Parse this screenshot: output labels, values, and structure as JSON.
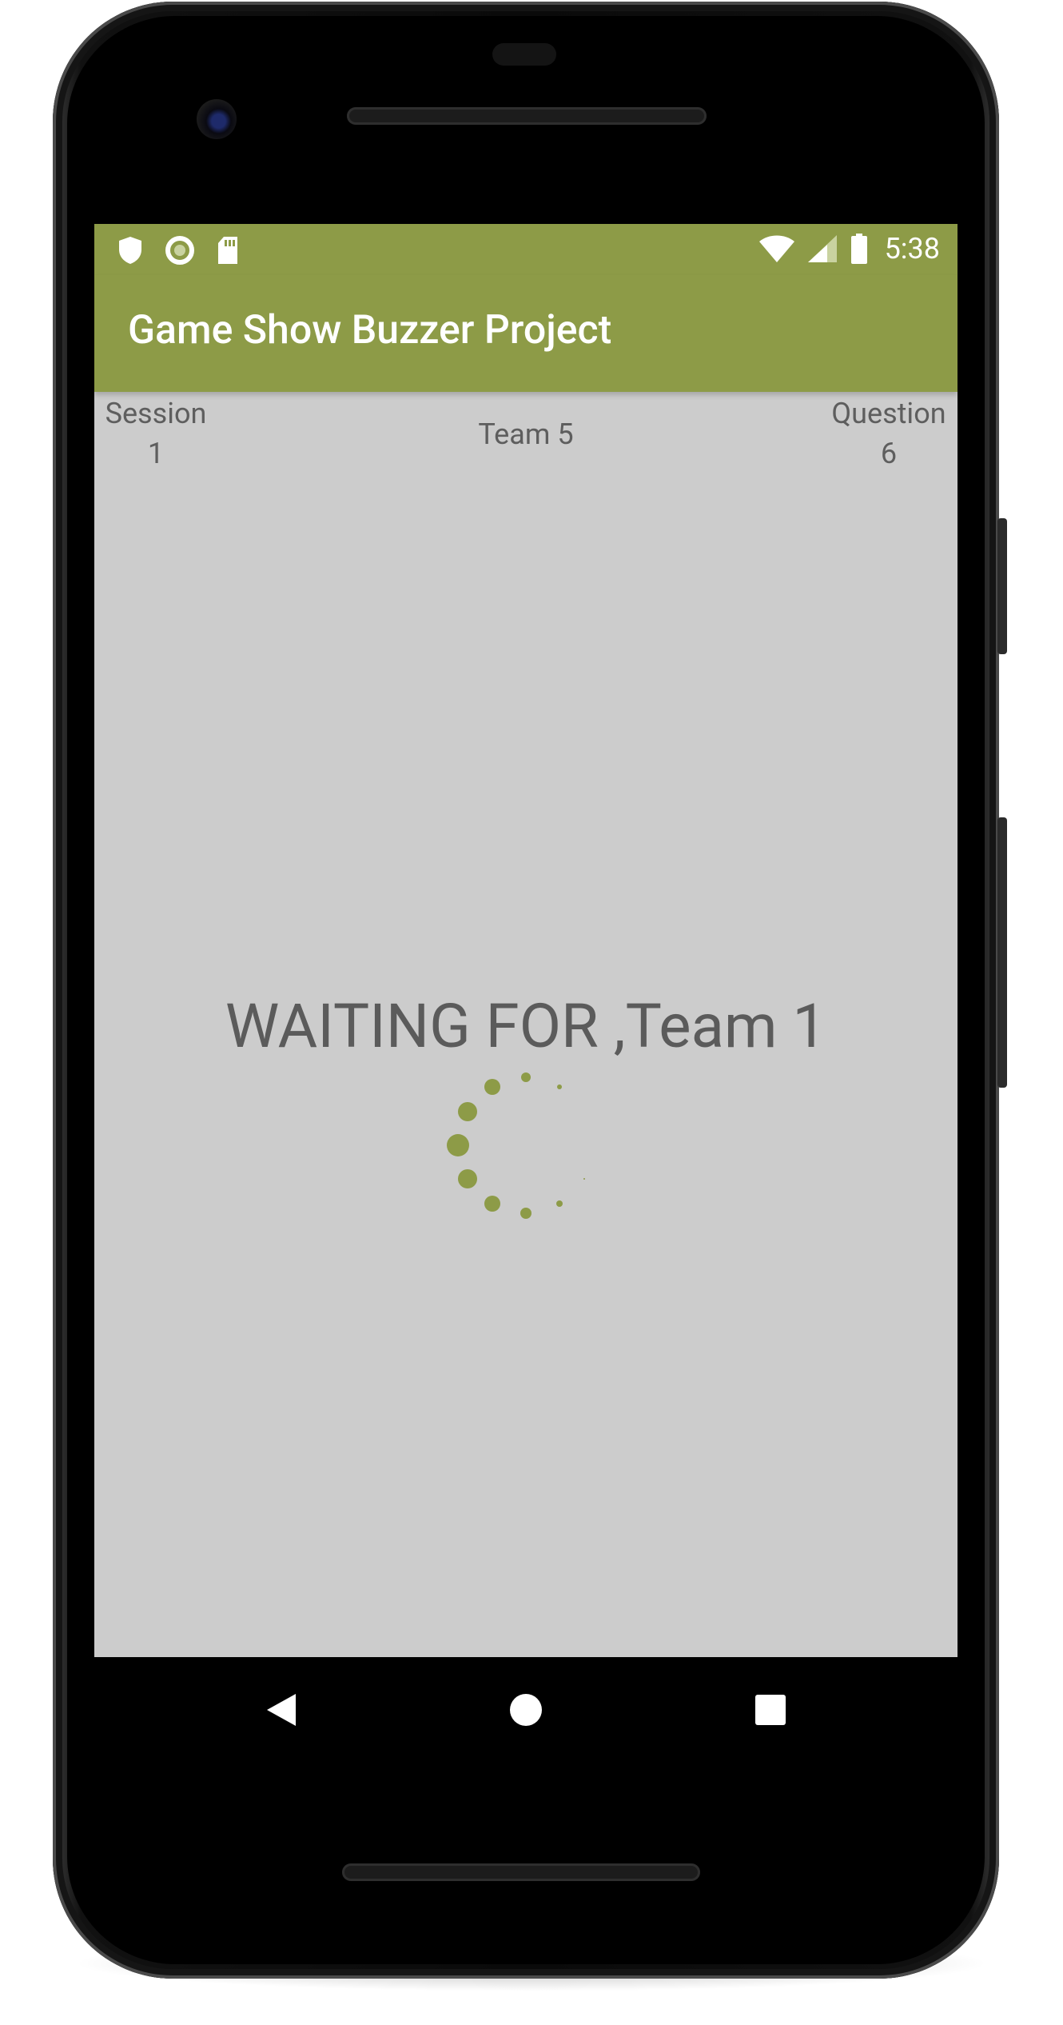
{
  "status_bar": {
    "time": "5:38",
    "left_icons": [
      "shield-icon",
      "circle-icon",
      "sd-card-icon"
    ],
    "right_icons": [
      "wifi-icon",
      "signal-icon",
      "battery-icon"
    ]
  },
  "app_bar": {
    "title": "Game Show Buzzer Project"
  },
  "header": {
    "session_label": "Session",
    "session_value": "1",
    "team_label": "Team 5",
    "question_label": "Question",
    "question_value": "6"
  },
  "main": {
    "waiting_text": "WAITING FOR ,Team 1",
    "spinner_color": "#8d9b47"
  },
  "nav_bar": {
    "buttons": [
      "back-icon",
      "home-icon",
      "recents-icon"
    ]
  },
  "colors": {
    "accent": "#8d9b47",
    "screen_bg": "#cccccc",
    "text": "#5e5e5e"
  }
}
